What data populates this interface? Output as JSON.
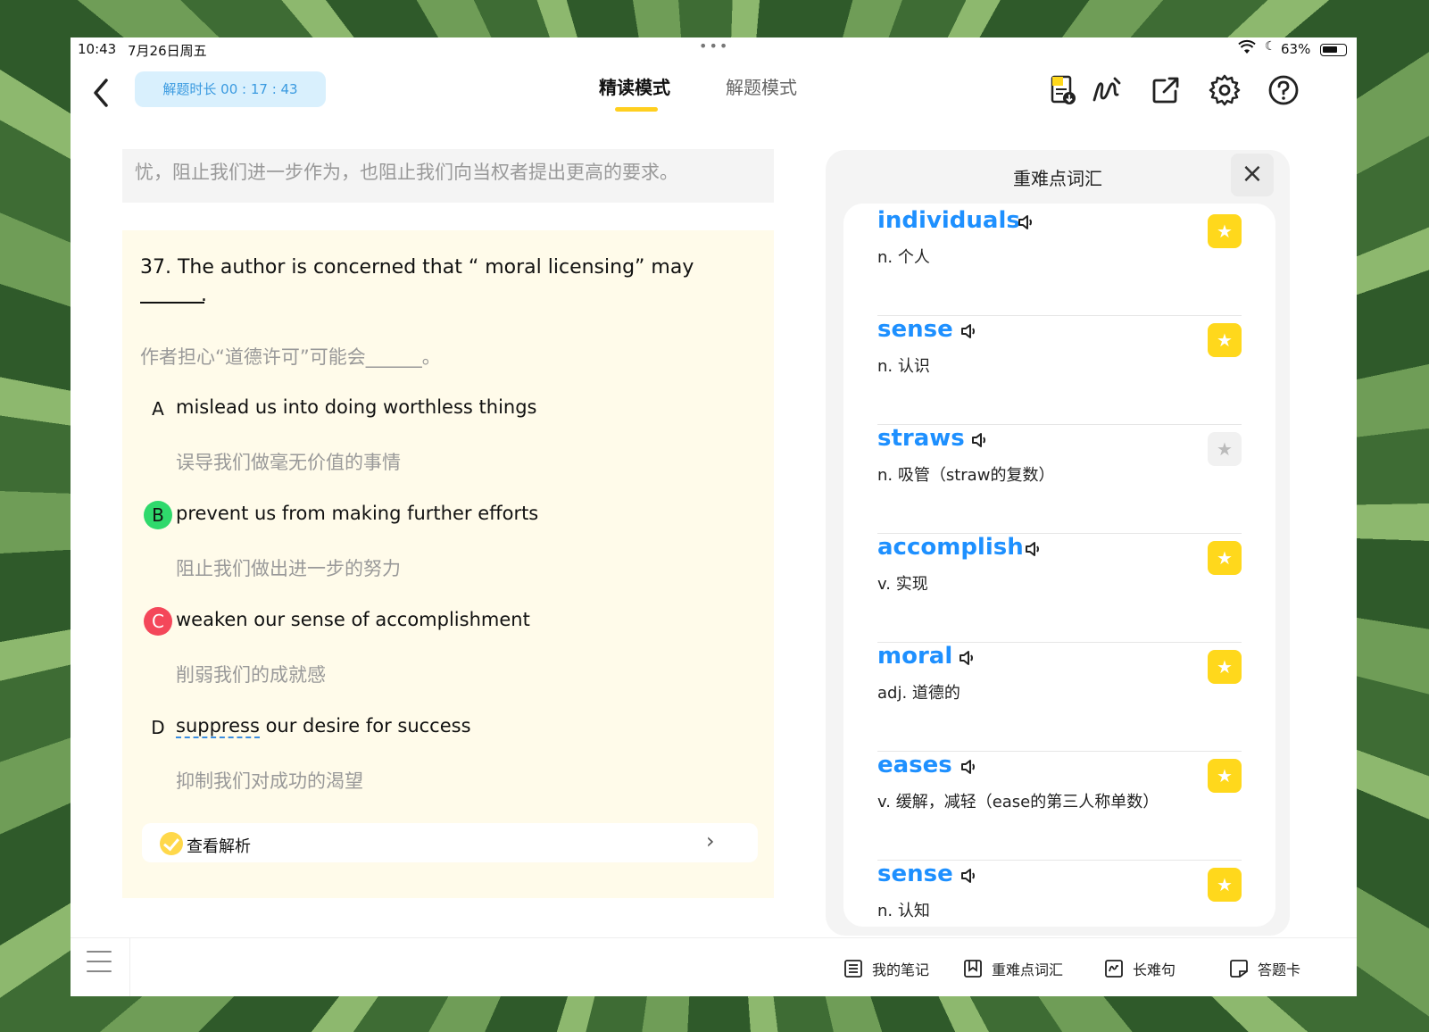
{
  "status_bar": {
    "time": "10:43",
    "date": "7月26日周五",
    "dots": "•••",
    "battery_pct": "63%"
  },
  "toolbar": {
    "back_icon": "chevron-left-icon",
    "timer_label": "解题时长 00 : 17 : 43",
    "tabs": [
      {
        "label": "精读模式",
        "active": true
      },
      {
        "label": "解题模式",
        "active": false
      }
    ],
    "icons": [
      "note-download-icon",
      "handwriting-icon",
      "share-icon",
      "gear-icon",
      "help-icon"
    ]
  },
  "passage": {
    "previous_paragraph": "忧，阻止我们进一步作为，也阻止我们向当权者提出更高的要求。"
  },
  "question": {
    "stem": "37. The author is concerned that “ moral licensing” may",
    "blank_end": ".",
    "translation": "作者担心“道德许可”可能会______。",
    "options": [
      {
        "letter": "A",
        "text": "mislead us into doing worthless things",
        "translation": "误导我们做毫无价值的事情",
        "state": "none"
      },
      {
        "letter": "B",
        "text": "prevent us from making further efforts",
        "translation": "阻止我们做出进一步的努力",
        "state": "correct"
      },
      {
        "letter": "C",
        "text": "weaken our sense of accomplishment",
        "translation": "削弱我们的成就感",
        "state": "wrong"
      },
      {
        "letter": "D",
        "text_dashed": "suppress",
        "text": " our desire for success",
        "translation": "抑制我们对成功的渴望",
        "state": "none"
      }
    ],
    "analysis_label": "查看解析",
    "analysis_chevron": "›"
  },
  "vocab_panel": {
    "title": "重难点词汇",
    "close_symbol": "×",
    "items": [
      {
        "word": "individuals",
        "definition": "n. 个人",
        "starred": true
      },
      {
        "word": "sense",
        "definition": "n. 认识",
        "starred": true
      },
      {
        "word": "straws",
        "definition": "n. 吸管（straw的复数）",
        "starred": false
      },
      {
        "word": "accomplish",
        "definition": "v. 实现",
        "starred": true
      },
      {
        "word": "moral",
        "definition": "adj. 道德的",
        "starred": true
      },
      {
        "word": "eases",
        "definition": "v. 缓解，减轻（ease的第三人称单数）",
        "starred": true
      },
      {
        "word": "sense",
        "definition": "n. 认知",
        "starred": true
      }
    ],
    "star_symbol": "★"
  },
  "bottom_bar": {
    "items": [
      {
        "label": "我的笔记",
        "icon": "notes-list-icon"
      },
      {
        "label": "重难点词汇",
        "icon": "bookmark-icon"
      },
      {
        "label": "长难句",
        "icon": "wave-icon"
      },
      {
        "label": "答题卡",
        "icon": "answer-card-icon"
      }
    ]
  },
  "colors": {
    "accent_yellow": "#ffcf1f",
    "word_blue": "#1e90ff",
    "correct_green": "#2fd96c",
    "wrong_red": "#f4475a",
    "card_bg": "#fffbea"
  }
}
